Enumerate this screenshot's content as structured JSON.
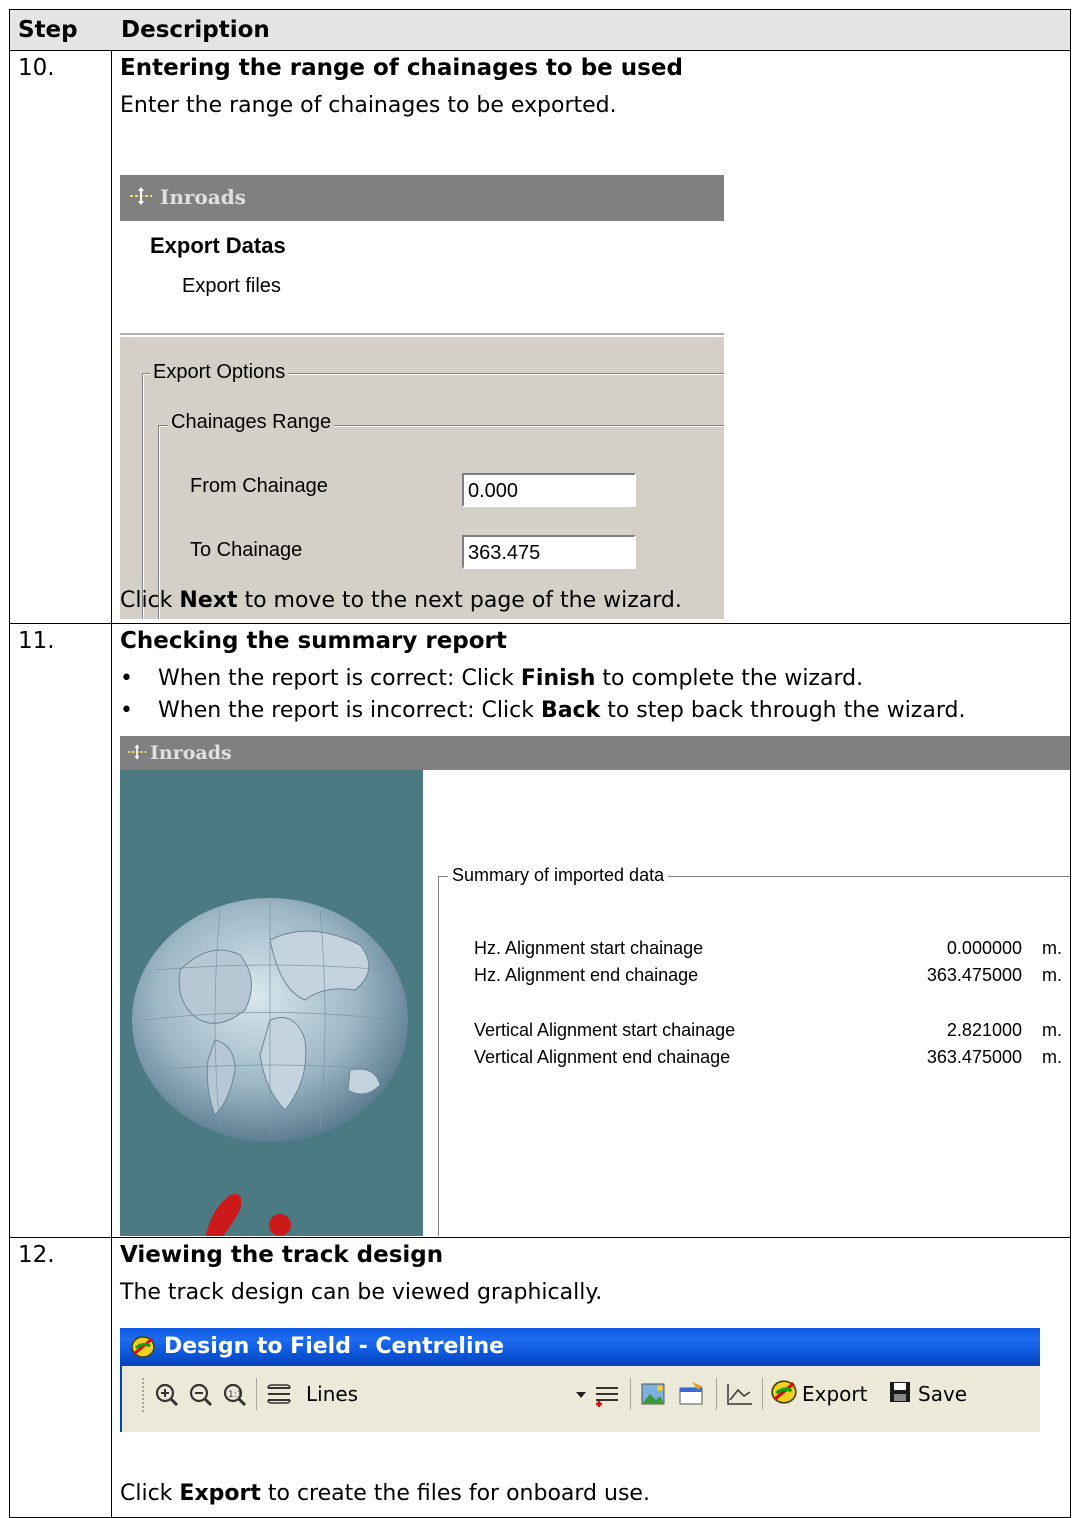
{
  "table": {
    "header": {
      "step": "Step",
      "description": "Description"
    },
    "rows": [
      {
        "step": "10.",
        "title": "Entering the range of chainages to be used",
        "intro": "Enter the range of chainages to be exported.",
        "dialog": {
          "window_title": "Inroads",
          "heading": "Export Datas",
          "subheading": "Export files",
          "group_outer": "Export Options",
          "group_inner": "Chainages Range",
          "from_label": "From Chainage",
          "from_value": "0.000",
          "to_label": "To Chainage",
          "to_value": "363.475"
        },
        "outro_pre": "Click ",
        "outro_bold": "Next",
        "outro_post": " to move to the next page of the wizard."
      },
      {
        "step": "11.",
        "title": "Checking the summary report",
        "bullets": [
          {
            "pre": "When the report is correct: Click ",
            "bold": "Finish",
            "post": " to complete the wizard."
          },
          {
            "pre": "When the report is incorrect: Click ",
            "bold": "Back",
            "post": " to step back through the wizard."
          }
        ],
        "dialog": {
          "window_title": "Inroads",
          "summary_label": "Summary of imported data",
          "entries": [
            {
              "label": "Hz. Alignment start chainage",
              "value": "0.000000",
              "unit": "m."
            },
            {
              "label": "Hz. Alignment end chainage",
              "value": "363.475000",
              "unit": "m."
            },
            {
              "label": "Vertical Alignment start chainage",
              "value": "2.821000",
              "unit": "m."
            },
            {
              "label": "Vertical Alignment end chainage",
              "value": "363.475000",
              "unit": "m."
            }
          ]
        }
      },
      {
        "step": "12.",
        "title": "Viewing the track design",
        "intro": "The track design can be viewed graphically.",
        "window": {
          "title": "Design to Field - Centreline",
          "combo_value": "Lines",
          "export_label": "Export",
          "save_label": "Save"
        },
        "outro_pre": "Click ",
        "outro_bold": "Export",
        "outro_post": " to create the files for onboard use."
      }
    ]
  },
  "colors": {
    "header_bg": "#e4e4e4",
    "dialog_bg": "#d4d0c8",
    "inroads_titlebar": "#808080",
    "xp_titlebar": "#0a58e0",
    "globe_panel": "#4b7a82"
  },
  "icons": [
    "inroads-app-icon",
    "zoom-in-icon",
    "zoom-out-icon",
    "zoom-extents-icon",
    "layers-icon",
    "layer-add-icon",
    "image-icon",
    "properties-icon",
    "profile-icon",
    "export-icon",
    "save-icon"
  ]
}
